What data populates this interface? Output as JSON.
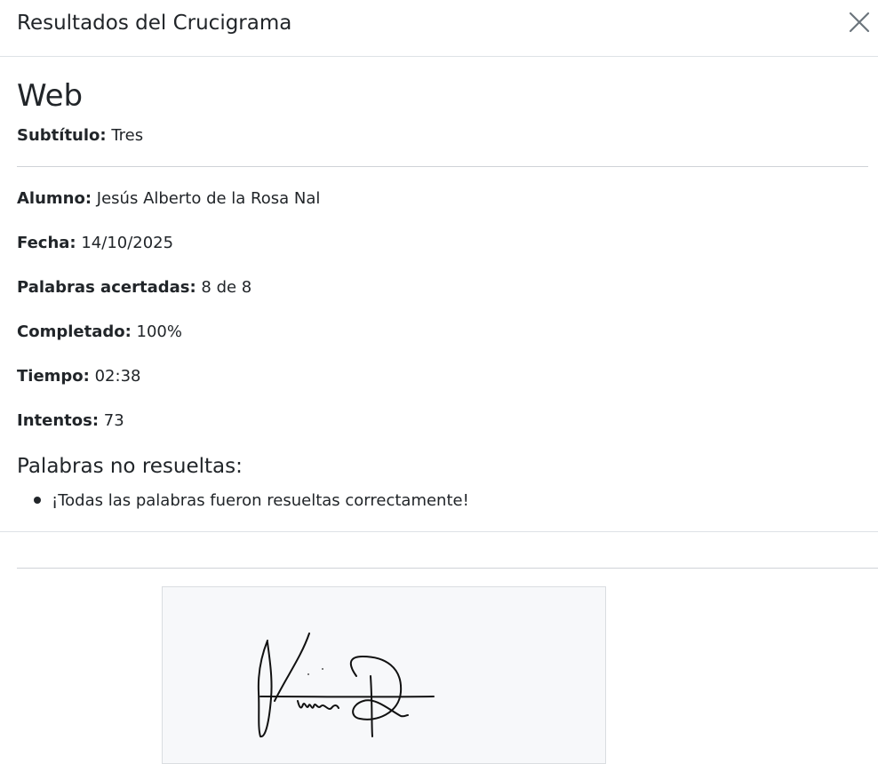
{
  "modal": {
    "title": "Resultados del Crucigrama",
    "close_icon": "close-icon"
  },
  "crossword": {
    "title": "Web",
    "subtitle_label": "Subtítulo:",
    "subtitle_value": "Tres"
  },
  "details": [
    {
      "label": "Alumno:",
      "value": "Jesús Alberto de la Rosa Nal"
    },
    {
      "label": "Fecha:",
      "value": "14/10/2025"
    },
    {
      "label": "Palabras acertadas:",
      "value": "8 de 8"
    },
    {
      "label": "Completado:",
      "value": "100%"
    },
    {
      "label": "Tiempo:",
      "value": "02:38"
    },
    {
      "label": "Intentos:",
      "value": "73"
    }
  ],
  "unsolved": {
    "title": "Palabras no resueltas:",
    "items": [
      "¡Todas las palabras fueron resueltas correctamente!"
    ]
  },
  "signature": {
    "kind": "handwritten-signature"
  }
}
